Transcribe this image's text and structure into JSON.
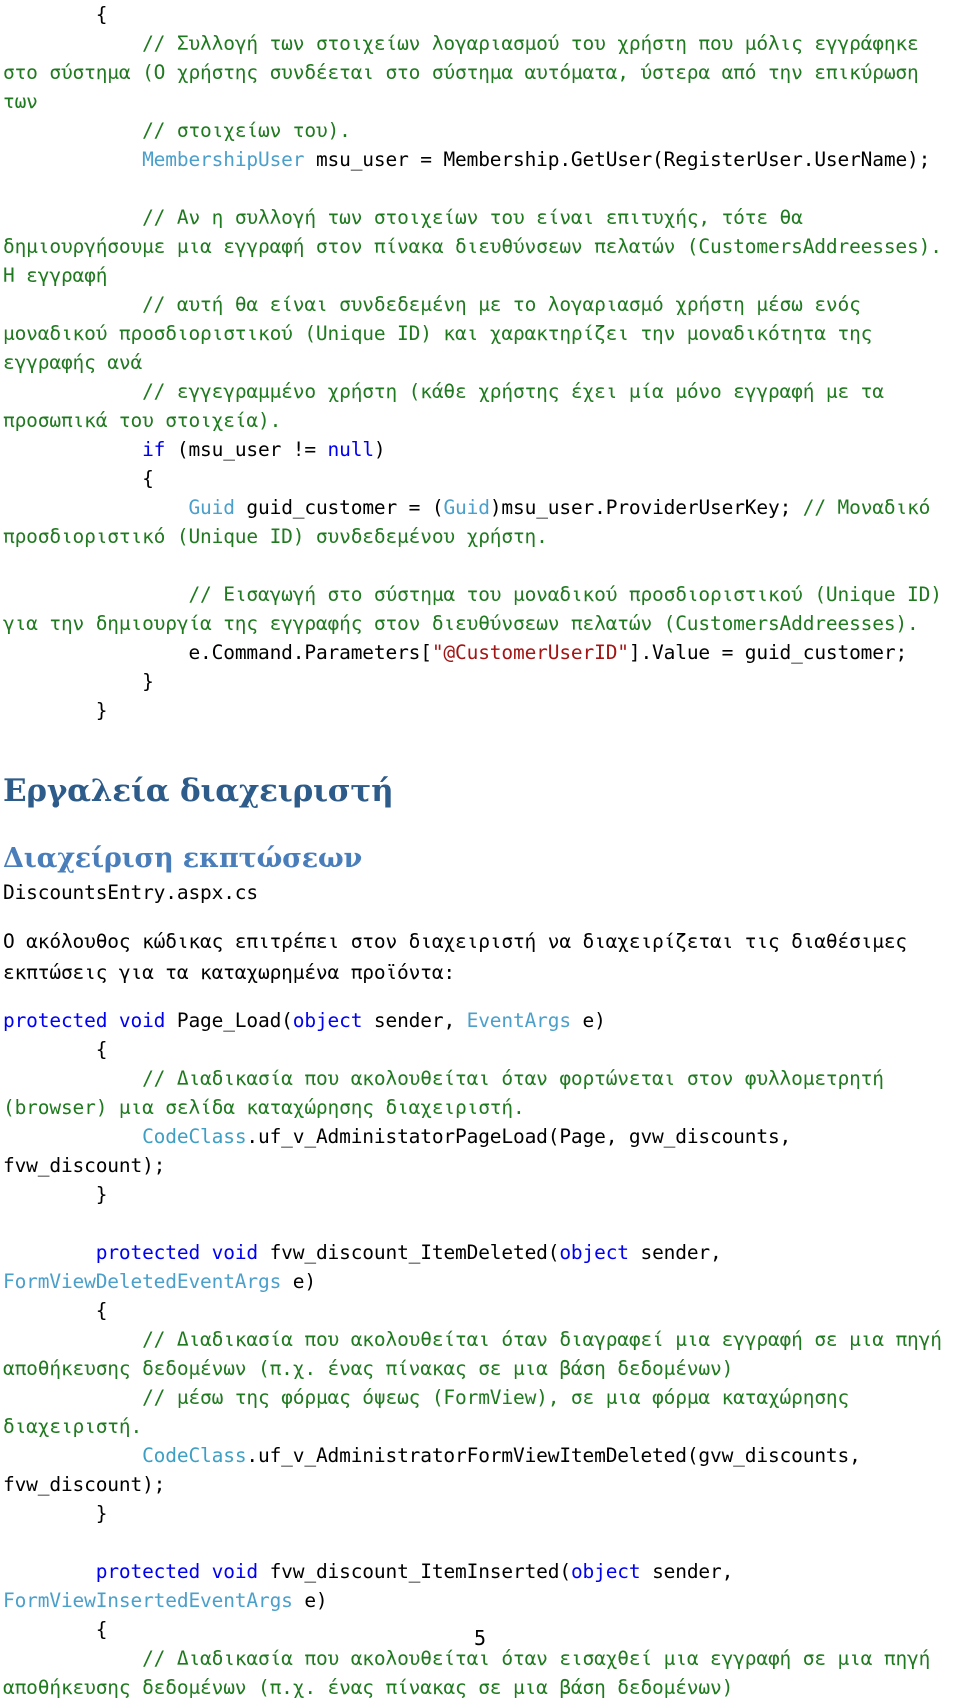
{
  "document": {
    "page_number": "5",
    "language": "el"
  },
  "code_block_1": {
    "lines": [
      {
        "segments": [
          {
            "text": "        {",
            "cls": ""
          }
        ]
      },
      {
        "segments": [
          {
            "text": "            // Συλλογή των στοιχείων λογαριασμού του χρήστη που μόλις εγγράφηκε στο σύστημα (Ο χρήστης συνδέεται στο σύστημα αυτόματα, ύστερα από την επικύρωση των",
            "cls": "cm"
          }
        ]
      },
      {
        "segments": [
          {
            "text": "            // στοιχείων του).",
            "cls": "cm"
          }
        ]
      },
      {
        "segments": [
          {
            "text": "            ",
            "cls": ""
          },
          {
            "text": "MembershipUser",
            "cls": "ty"
          },
          {
            "text": " msu_user = Membership.GetUser(RegisterUser.UserName);",
            "cls": ""
          }
        ]
      },
      {
        "segments": [
          {
            "text": "",
            "cls": ""
          }
        ]
      },
      {
        "segments": [
          {
            "text": "            // Αν η συλλογή των στοιχείων του είναι επιτυχής, τότε θα δημιουργήσουμε μια εγγραφή στον πίνακα διευθύνσεων πελατών (CustomersAddreesses). Η εγγραφή",
            "cls": "cm"
          }
        ]
      },
      {
        "segments": [
          {
            "text": "            // αυτή θα είναι συνδεδεμένη με το λογαριασμό χρήστη μέσω ενός μοναδικού προσδιοριστικού (Unique ID) και χαρακτηρίζει την μοναδικότητα της εγγραφής ανά",
            "cls": "cm"
          }
        ]
      },
      {
        "segments": [
          {
            "text": "            // εγγεγραμμένο χρήστη (κάθε χρήστης έχει μία μόνο εγγραφή με τα προσωπικά του στοιχεία).",
            "cls": "cm"
          }
        ]
      },
      {
        "segments": [
          {
            "text": "            ",
            "cls": ""
          },
          {
            "text": "if",
            "cls": "kw"
          },
          {
            "text": " (msu_user != ",
            "cls": ""
          },
          {
            "text": "null",
            "cls": "kw"
          },
          {
            "text": ")",
            "cls": ""
          }
        ]
      },
      {
        "segments": [
          {
            "text": "            {",
            "cls": ""
          }
        ]
      },
      {
        "segments": [
          {
            "text": "                ",
            "cls": ""
          },
          {
            "text": "Guid",
            "cls": "ty"
          },
          {
            "text": " guid_customer = (",
            "cls": ""
          },
          {
            "text": "Guid",
            "cls": "ty"
          },
          {
            "text": ")msu_user.ProviderUserKey; ",
            "cls": ""
          },
          {
            "text": "// Μοναδικό προσδιοριστικό (Unique ID) συνδεδεμένου χρήστη.",
            "cls": "cm"
          }
        ]
      },
      {
        "segments": [
          {
            "text": "",
            "cls": ""
          }
        ]
      },
      {
        "segments": [
          {
            "text": "                // Εισαγωγή στο σύστημα του μοναδικού προσδιοριστικού (Unique ID) για την δημιουργία της εγγραφής στον διευθύνσεων πελατών (CustomersAddreesses).",
            "cls": "cm"
          }
        ]
      },
      {
        "segments": [
          {
            "text": "                e.Command.Parameters[",
            "cls": ""
          },
          {
            "text": "\"@CustomerUserID\"",
            "cls": "str"
          },
          {
            "text": "].Value = guid_customer;",
            "cls": ""
          }
        ]
      },
      {
        "segments": [
          {
            "text": "            }",
            "cls": ""
          }
        ]
      },
      {
        "segments": [
          {
            "text": "        }",
            "cls": ""
          }
        ]
      }
    ]
  },
  "heading_1": "Εργαλεία διαχειριστή",
  "heading_2": "Διαχείριση εκπτώσεων",
  "filename": "DiscountsEntry.aspx.cs",
  "paragraph_1": "Ο ακόλουθος κώδικας επιτρέπει στον διαχειριστή να διαχειρίζεται τις διαθέσιμες εκπτώσεις για τα καταχωρημένα προϊόντα:",
  "code_block_2": {
    "lines": [
      {
        "segments": [
          {
            "text": "",
            "cls": ""
          },
          {
            "text": "protected void",
            "cls": "kw"
          },
          {
            "text": " Page_Load(",
            "cls": ""
          },
          {
            "text": "object",
            "cls": "kw"
          },
          {
            "text": " sender, ",
            "cls": ""
          },
          {
            "text": "EventArgs",
            "cls": "ty"
          },
          {
            "text": " e)",
            "cls": ""
          }
        ]
      },
      {
        "segments": [
          {
            "text": "        {",
            "cls": ""
          }
        ]
      },
      {
        "segments": [
          {
            "text": "            // Διαδικασία που ακολουθείται όταν φορτώνεται στον φυλλομετρητή (browser) μια σελίδα καταχώρησης διαχειριστή.",
            "cls": "cm"
          }
        ]
      },
      {
        "segments": [
          {
            "text": "            ",
            "cls": ""
          },
          {
            "text": "CodeClass",
            "cls": "ty2"
          },
          {
            "text": ".uf_v_AdministatorPageLoad(Page, gvw_discounts, fvw_discount);",
            "cls": ""
          }
        ]
      },
      {
        "segments": [
          {
            "text": "        }",
            "cls": ""
          }
        ]
      },
      {
        "segments": [
          {
            "text": "",
            "cls": ""
          }
        ]
      },
      {
        "segments": [
          {
            "text": "        ",
            "cls": ""
          },
          {
            "text": "protected void",
            "cls": "kw"
          },
          {
            "text": " fvw_discount_ItemDeleted(",
            "cls": ""
          },
          {
            "text": "object",
            "cls": "kw"
          },
          {
            "text": " sender, ",
            "cls": ""
          },
          {
            "text": "FormViewDeletedEventArgs",
            "cls": "ty"
          },
          {
            "text": " e)",
            "cls": ""
          }
        ]
      },
      {
        "segments": [
          {
            "text": "        {",
            "cls": ""
          }
        ]
      },
      {
        "segments": [
          {
            "text": "            // Διαδικασία που ακολουθείται όταν διαγραφεί μια εγγραφή σε μια πηγή αποθήκευσης δεδομένων (π.χ. ένας πίνακας σε μια βάση δεδομένων)",
            "cls": "cm"
          }
        ]
      },
      {
        "segments": [
          {
            "text": "            // μέσω της φόρμας όψεως (FormView), σε μια φόρμα καταχώρησης διαχειριστή.",
            "cls": "cm"
          }
        ]
      },
      {
        "segments": [
          {
            "text": "            ",
            "cls": ""
          },
          {
            "text": "CodeClass",
            "cls": "ty2"
          },
          {
            "text": ".uf_v_AdministratorFormViewItemDeleted(gvw_discounts, fvw_discount);",
            "cls": ""
          }
        ]
      },
      {
        "segments": [
          {
            "text": "        }",
            "cls": ""
          }
        ]
      },
      {
        "segments": [
          {
            "text": "",
            "cls": ""
          }
        ]
      },
      {
        "segments": [
          {
            "text": "        ",
            "cls": ""
          },
          {
            "text": "protected void",
            "cls": "kw"
          },
          {
            "text": " fvw_discount_ItemInserted(",
            "cls": ""
          },
          {
            "text": "object",
            "cls": "kw"
          },
          {
            "text": " sender, ",
            "cls": ""
          },
          {
            "text": "FormViewInsertedEventArgs",
            "cls": "ty"
          },
          {
            "text": " e)",
            "cls": ""
          }
        ]
      },
      {
        "segments": [
          {
            "text": "        {",
            "cls": ""
          }
        ]
      },
      {
        "segments": [
          {
            "text": "            // Διαδικασία που ακολουθείται όταν εισαχθεί μια εγγραφή σε μια πηγή αποθήκευσης δεδομένων (π.χ. ένας πίνακας σε μια βάση δεδομένων)",
            "cls": "cm"
          }
        ]
      }
    ]
  }
}
